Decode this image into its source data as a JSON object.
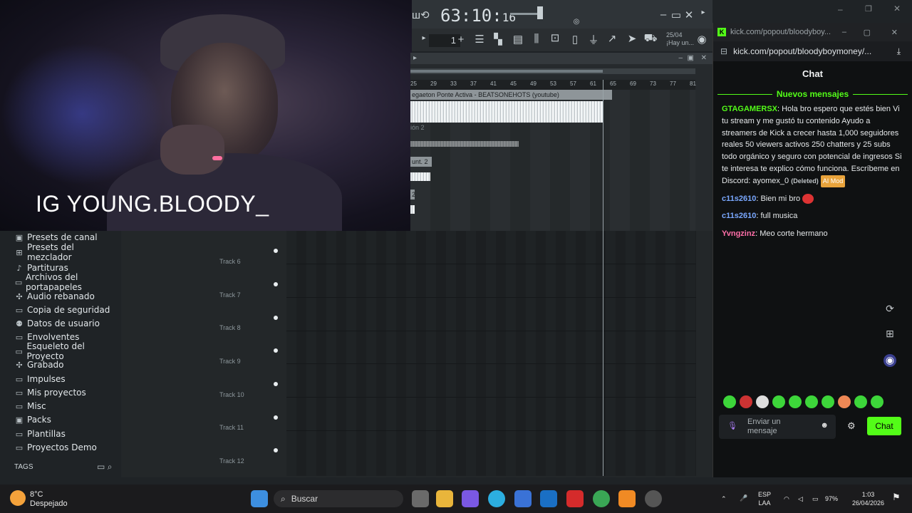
{
  "webcam": {
    "overlay_text": "IG YOUNG.BLOODY_"
  },
  "fl_toolbar": {
    "time_main": "63:10:",
    "time_ticks": "16",
    "pattern_num": "1",
    "hint_date": "25/04",
    "hint_text": "¡Hay un..."
  },
  "playlist": {
    "ruler": [
      "25",
      "29",
      "33",
      "37",
      "41",
      "45",
      "49",
      "53",
      "57",
      "61",
      "65",
      "69",
      "73",
      "77",
      "81"
    ],
    "clip1": "egaeton Ponte Activa - BEATSONEHOTS (youtube)",
    "clip2": "ión 2",
    "clip3": "unt. 2",
    "clip4": "2"
  },
  "browser": {
    "items": [
      {
        "icon": "▣",
        "label": "Presets de canal"
      },
      {
        "icon": "⊞",
        "label": "Presets del mezclador"
      },
      {
        "icon": "♪",
        "label": "Partituras"
      },
      {
        "icon": "▭",
        "label": "Archivos del portapapeles"
      },
      {
        "icon": "✣",
        "label": "Audio rebanado"
      },
      {
        "icon": "▭",
        "label": "Copia de seguridad"
      },
      {
        "icon": "⚉",
        "label": "Datos de usuario"
      },
      {
        "icon": "▭",
        "label": "Envolventes"
      },
      {
        "icon": "▭",
        "label": "Esqueleto del Proyecto"
      },
      {
        "icon": "✣",
        "label": "Grabado"
      },
      {
        "icon": "▭",
        "label": "Impulses"
      },
      {
        "icon": "▭",
        "label": "Mis proyectos"
      },
      {
        "icon": "▭",
        "label": "Misc"
      },
      {
        "icon": "▣",
        "label": "Packs"
      },
      {
        "icon": "▭",
        "label": "Plantillas"
      },
      {
        "icon": "▭",
        "label": "Proyectos Demo"
      }
    ],
    "tags_label": "TAGS"
  },
  "tracks": [
    "Track 6",
    "Track 7",
    "Track 8",
    "Track 9",
    "Track 10",
    "Track 11",
    "Track 12"
  ],
  "chat": {
    "window_title": "kick.com/popout/bloodyboy...",
    "url": "kick.com/popout/bloodyboymoney/...",
    "heading": "Chat",
    "new_messages": "Nuevos mensajes",
    "messages": [
      {
        "user": "GTAGAMERSX",
        "text": "Hola bro espero que estés bien Vi tu stream y me gustó tu contenido Ayudo a streamers de Kick a crecer hasta 1,000 seguidores reales 50 viewers activos 250 chatters y 25 subs todo orgánico y seguro con potencial de ingresos Si te interesa te explico cómo funciona. Escríbeme en Discord: ayomex_0",
        "deleted": "(Deleted)",
        "badge": "AI Mod"
      },
      {
        "user": "c11s2610",
        "text": "Bien mi bro"
      },
      {
        "user": "c11s2610",
        "text": "full musica"
      },
      {
        "user": "Yvngzinz",
        "text": "Meo corte hermano"
      }
    ],
    "input_placeholder": "Enviar un mensaje",
    "send_label": "Chat"
  },
  "taskbar": {
    "temp": "8°C",
    "weather": "Despejado",
    "search": "Buscar",
    "lang1": "ESP",
    "lang2": "LAA",
    "battery": "97%",
    "time": "1:03",
    "date": "26/04/2026"
  }
}
